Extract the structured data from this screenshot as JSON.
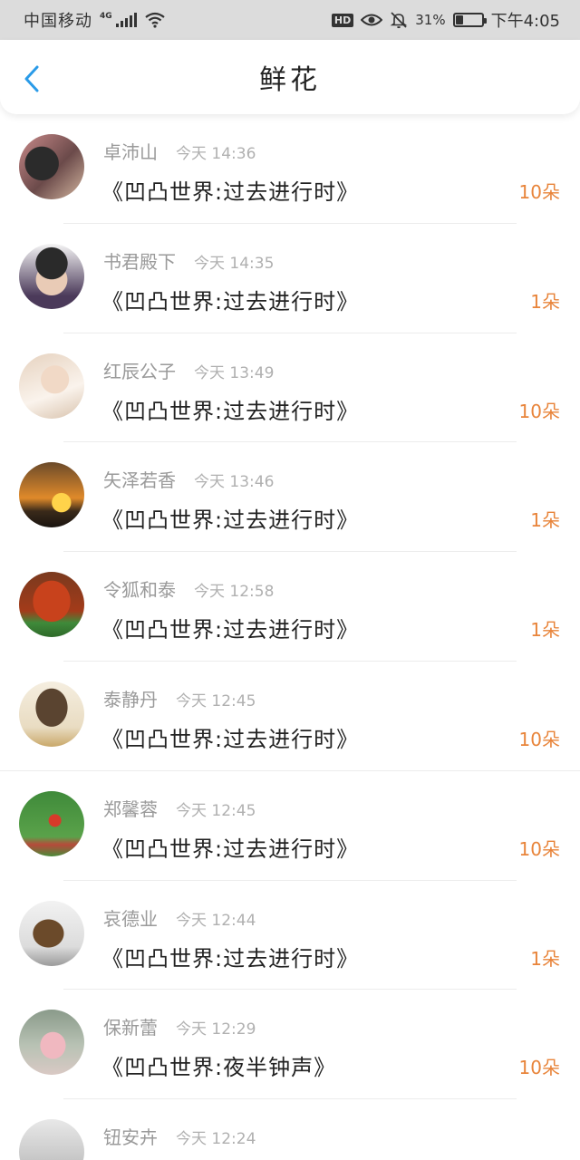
{
  "status_bar": {
    "carrier": "中国移动",
    "network": "4G",
    "hd": "HD",
    "battery": "31%",
    "battery_level": 0.31,
    "time": "下午4:05"
  },
  "header": {
    "title": "鲜花",
    "back_icon": "chevron-left-icon"
  },
  "colors": {
    "accent": "#2a9be8",
    "count": "#e8843a"
  },
  "records": [
    {
      "name": "卓沛山",
      "time": "今天 14:36",
      "title": "《凹凸世界:过去进行时》",
      "count": "10朵"
    },
    {
      "name": "书君殿下",
      "time": "今天 14:35",
      "title": "《凹凸世界:过去进行时》",
      "count": "1朵"
    },
    {
      "name": "红辰公子",
      "time": "今天 13:49",
      "title": "《凹凸世界:过去进行时》",
      "count": "10朵"
    },
    {
      "name": "矢泽若香",
      "time": "今天 13:46",
      "title": "《凹凸世界:过去进行时》",
      "count": "1朵"
    },
    {
      "name": "令狐和泰",
      "time": "今天 12:58",
      "title": "《凹凸世界:过去进行时》",
      "count": "1朵"
    },
    {
      "name": "泰静丹",
      "time": "今天 12:45",
      "title": "《凹凸世界:过去进行时》",
      "count": "10朵"
    },
    {
      "name": "郑馨蓉",
      "time": "今天 12:45",
      "title": "《凹凸世界:过去进行时》",
      "count": "10朵"
    },
    {
      "name": "哀德业",
      "time": "今天 12:44",
      "title": "《凹凸世界:过去进行时》",
      "count": "1朵"
    },
    {
      "name": "保新蕾",
      "time": "今天 12:29",
      "title": "《凹凸世界:夜半钟声》",
      "count": "10朵"
    },
    {
      "name": "钮安卉",
      "time": "今天 12:24",
      "title": "",
      "count": ""
    }
  ]
}
